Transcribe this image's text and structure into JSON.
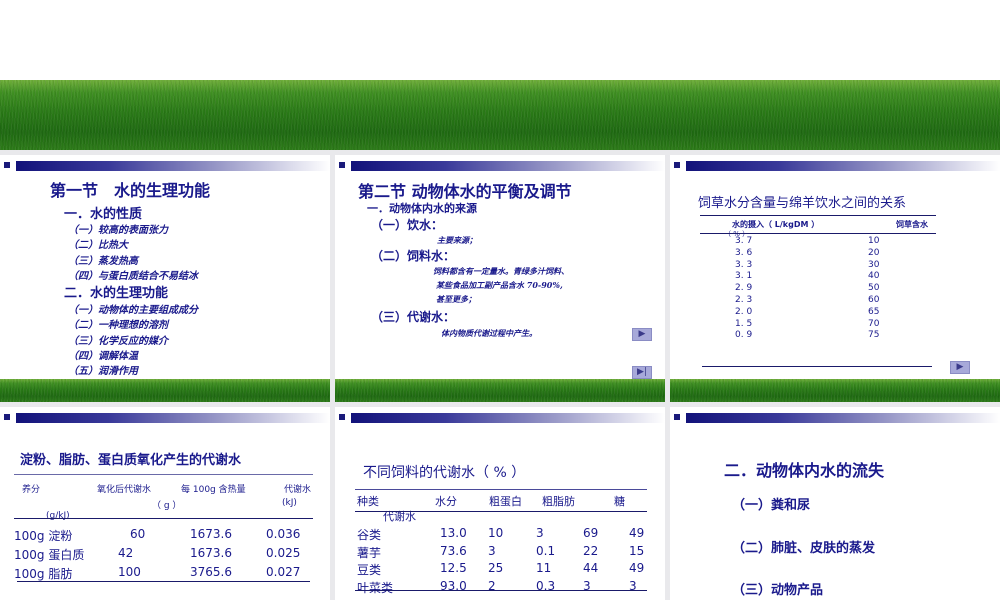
{
  "slide1": {
    "title": "第一节　水的生理功能",
    "sec1": "一．水的性质",
    "items1": [
      "（一）较高的表面张力",
      "（二）比热大",
      "（三）蒸发热高",
      "（四）与蛋白质结合不易结冰"
    ],
    "sec2": "二．水的生理功能",
    "items2": [
      "（一）动物体的主要组成成分",
      "（二）一种理想的溶剂",
      "（三）化学反应的媒介",
      "（四）调解体温",
      "（五）润滑作用"
    ]
  },
  "slide2": {
    "title": "第二节  动物体水的平衡及调节",
    "sec1": "一．动物体内水的来源",
    "sub1": "（一）饮水：",
    "sub1_text": "主要来源；",
    "sub2": "（二）饲料水：",
    "sub2_lines": [
      "饲料都含有一定量水。青绿多汁饲料、",
      "某些食品加工副产品含水 70-90%,",
      "甚至更多；"
    ],
    "sub3": "（三）代谢水：",
    "sub3_text": "体内物质代谢过程中产生。",
    "next_icon": "play-icon",
    "end_icon": "skip-end-icon"
  },
  "slide3": {
    "title": "饲草水分含量与绵羊饮水之间的关系",
    "col1": "水的摄入（ L/kgDM ）",
    "col1_unit": "（ % ）",
    "col2": "饲草含水",
    "rows": [
      [
        "3. 7",
        "10"
      ],
      [
        "3. 6",
        "20"
      ],
      [
        "3. 3",
        "30"
      ],
      [
        "3. 1",
        "40"
      ],
      [
        "2. 9",
        "50"
      ],
      [
        "2. 3",
        "60"
      ],
      [
        "2. 0",
        "65"
      ],
      [
        "1. 5",
        "70"
      ],
      [
        "0. 9",
        "75"
      ]
    ],
    "next_icon": "play-icon"
  },
  "slide4": {
    "title": "淀粉、脂肪、蛋白质氧化产生的代谢水",
    "headers": [
      "养分",
      "氧化后代谢水",
      "每 100g 含热量",
      "代谢水"
    ],
    "header_units": [
      "(g/kJ)",
      "（ g ）",
      "(kJ)"
    ],
    "rows": [
      [
        "100g 淀粉",
        "60",
        "1673.6",
        "0.036"
      ],
      [
        "100g 蛋白质",
        "42",
        "1673.6",
        "0.025"
      ],
      [
        "100g 脂肪",
        "100",
        "3765.6",
        "0.027"
      ]
    ]
  },
  "slide5": {
    "title": "不同饲料的代谢水（ % ）",
    "headers": [
      "种类",
      "水分",
      "粗蛋白",
      "粗脂肪",
      "糖"
    ],
    "header2": "代谢水",
    "rows": [
      [
        "谷类",
        "13.0",
        "10",
        "3",
        "69",
        "49"
      ],
      [
        "薯芋",
        "73.6",
        "3",
        "0.1",
        "22",
        "15"
      ],
      [
        "豆类",
        "12.5",
        "25",
        "11",
        "44",
        "49"
      ],
      [
        "叶菜类",
        "93.0",
        "2",
        "0.3",
        "3",
        "3"
      ]
    ]
  },
  "slide6": {
    "title": "二．动物体内水的流失",
    "items": [
      "（一）粪和尿",
      "（二）肺脏、皮肤的蒸发",
      "（三）动物产品"
    ]
  },
  "colors": {
    "text": "#1a1a8c",
    "header_bar": "#12127a",
    "nav_button": "#a7a9d9"
  }
}
